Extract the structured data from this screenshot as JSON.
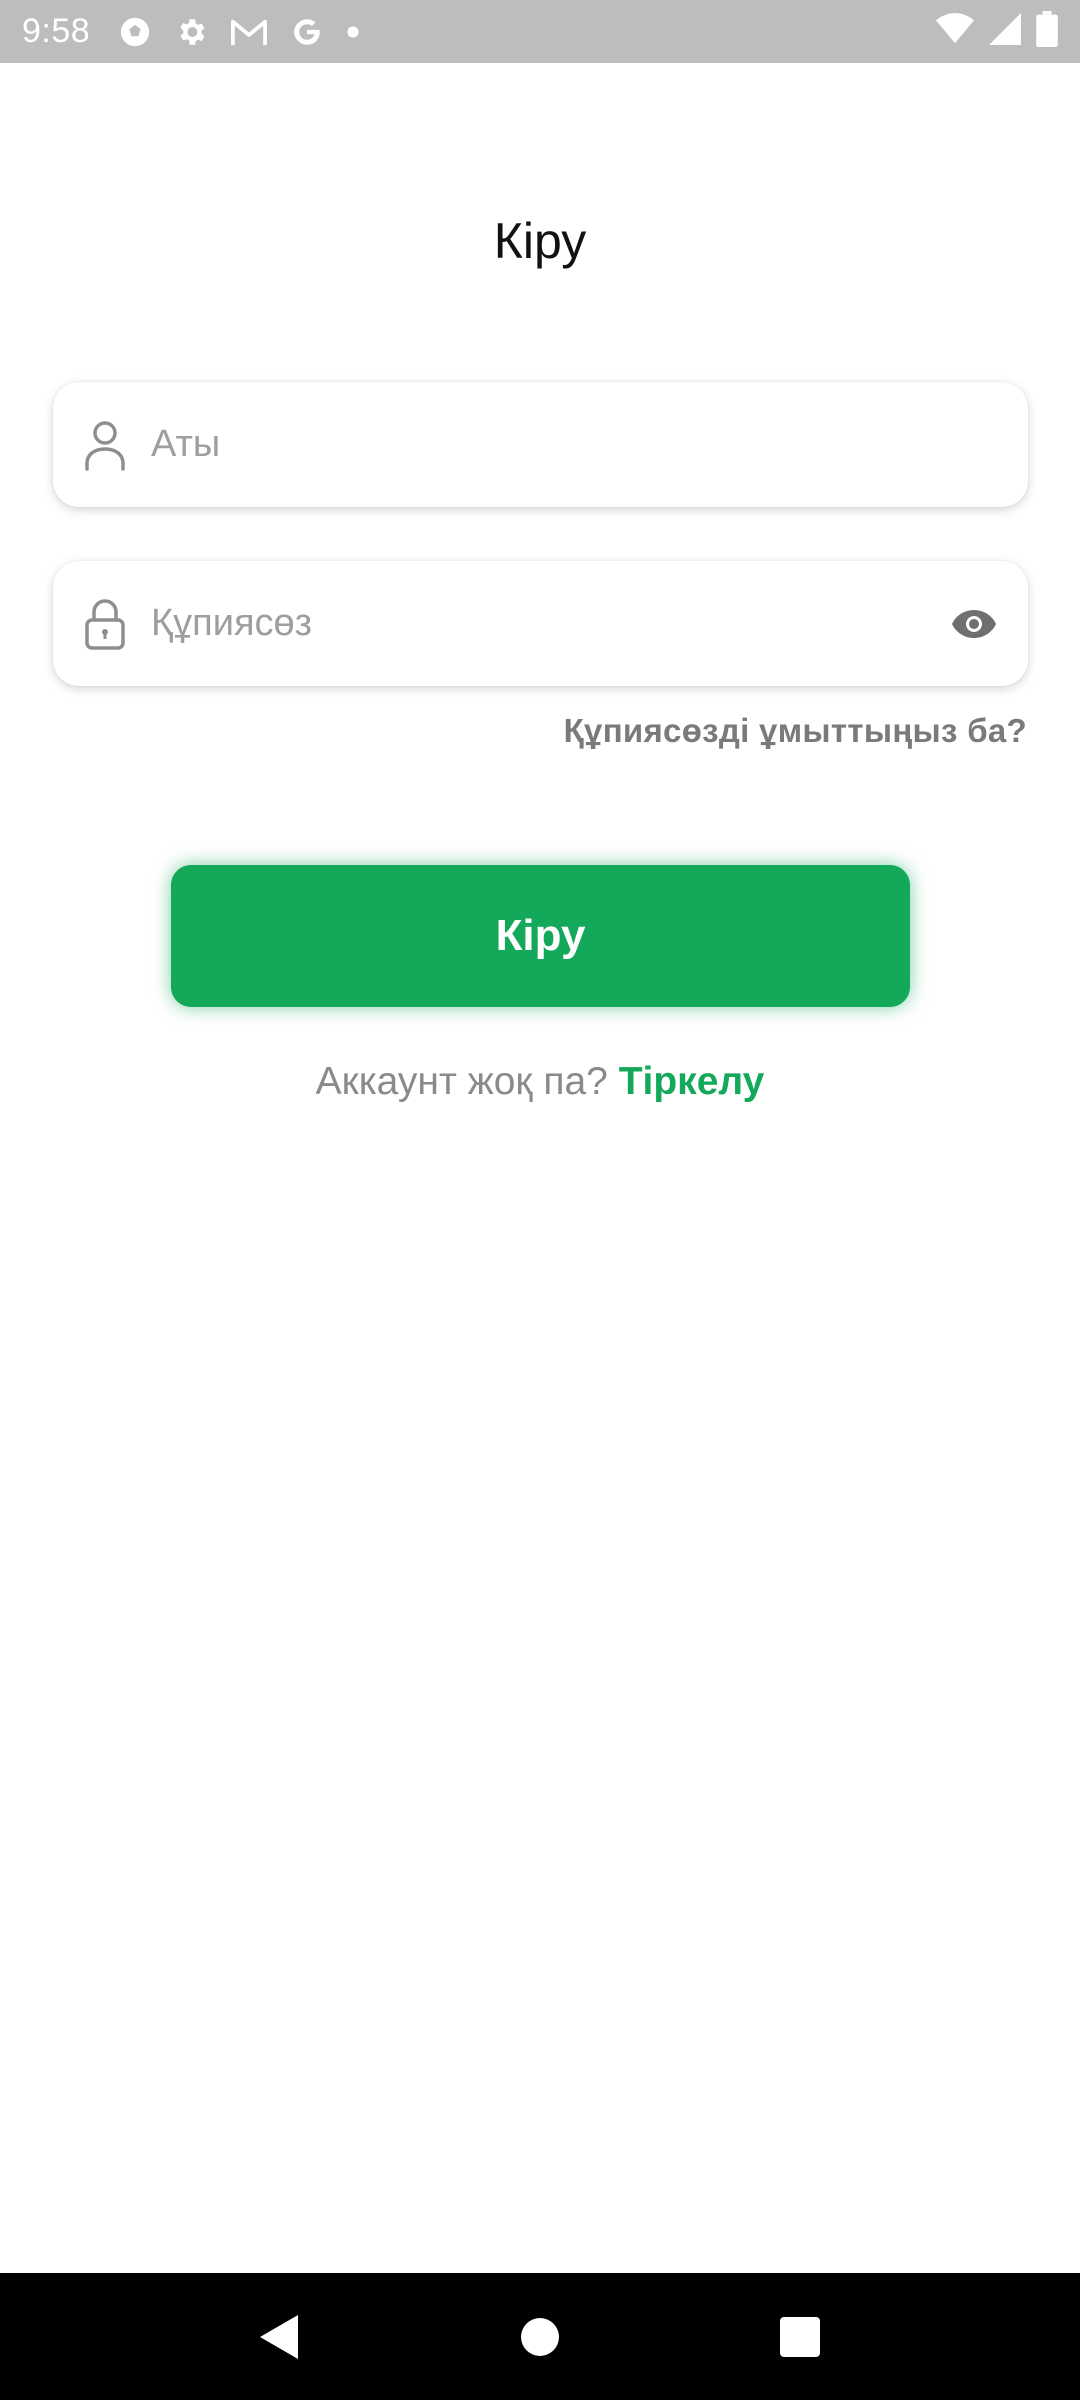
{
  "status_bar": {
    "time": "9:58",
    "left_icons": [
      "soccer-ball-icon",
      "gear-icon",
      "gmail-icon",
      "google-icon",
      "dot-icon"
    ],
    "right_icons": [
      "wifi-icon",
      "signal-icon",
      "battery-icon"
    ]
  },
  "page": {
    "title": "Кіру"
  },
  "form": {
    "username_placeholder": "Аты",
    "password_placeholder": "Құпиясөз",
    "forgot_password": "Құпиясөзді ұмыттыңыз ба?",
    "login_button": "Кіру",
    "no_account_text": "Аккаунт жоқ па?",
    "register_link": "Тіркелу"
  },
  "colors": {
    "accent": "#13a85a",
    "status_bar_bg": "#bdbdbd",
    "nav_bar_bg": "#000000",
    "placeholder": "#9e9e9e",
    "secondary_text": "#8a8a8a"
  },
  "nav_bar": {
    "buttons": [
      "back-icon",
      "home-icon",
      "recents-icon"
    ]
  }
}
